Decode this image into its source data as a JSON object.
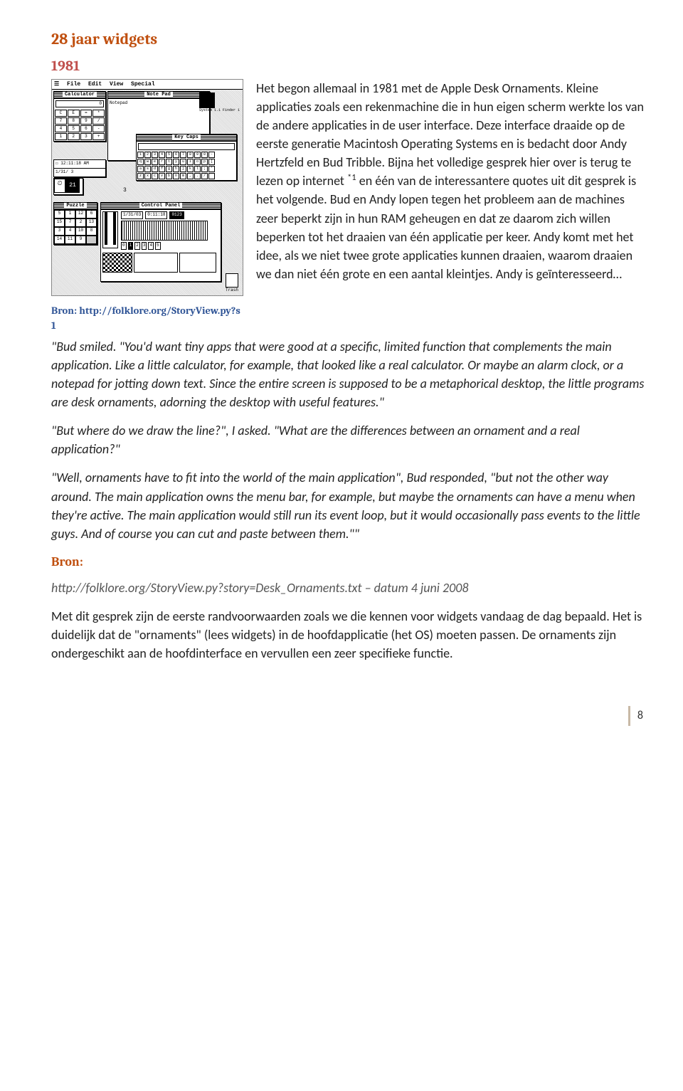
{
  "title": "28 jaar widgets",
  "year": "1981",
  "figure": {
    "caption": "Bron: http://folklore.org/StoryView.py?s 1",
    "menubar": [
      "File",
      "Edit",
      "View",
      "Special"
    ],
    "windows": {
      "calculator": "Calculator",
      "notepad": "Note Pad",
      "notepad_inner": "Notepad",
      "keycaps": "Key Caps",
      "puzzle": "Puzzle",
      "control_panel": "Control Panel",
      "clock_text": "12:11:18 AM",
      "calendar_text": "1/31/ 3",
      "cp_date": "1/31/03",
      "cp_time": "0:11:18",
      "system_label": "System 1.1 Finder 1",
      "trash": "Trash"
    }
  },
  "paragraphs": {
    "p1_a": "Het begon allemaal in 1981 met de Apple Desk Ornaments. Kleine applicaties zoals een rekenmachine die in hun eigen scherm werkte los van de andere applicaties in de user interface. Deze interface draaide op de eerste generatie Macintosh Operating Systems en is bedacht door Andy Hertzfeld en Bud Tribble. Bijna het volledige gesprek hier over is terug te lezen op internet ",
    "p1_sup": "*1",
    "p1_b": " en één van de interessantere quotes uit dit gesprek is het volgende. Bud en Andy lopen tegen het probleem aan de machines zeer beperkt zijn in hun RAM geheugen en dat ze daarom zich willen beperken tot het draaien van één applicatie per keer. Andy komt met het idee, als we niet twee grote applicaties kunnen draaien, waarom draaien we dan niet één grote en een aantal kleintjes. Andy is geïnteresseerd…",
    "quote1": "\"Bud smiled. \"You'd want tiny apps that were good at a specific, limited function that complements the main application. Like a little calculator, for example, that looked like a real calculator. Or maybe an alarm clock, or a notepad for jotting down text. Since the entire screen is supposed to be a metaphorical desktop, the little programs are desk ornaments, adorning the desktop with useful features.\"",
    "quote2": "\"But where do we draw the line?\", I asked. \"What are the differences between an ornament and a real application?\"",
    "quote3": "\"Well, ornaments have to fit into the world of the main application\", Bud responded, \"but not the other way around. The main application owns the menu bar, for example, but maybe the ornaments can have a menu when they're active. The main application would still run its event loop, but it would occasionally pass events to the little guys. And of course you can cut and paste between them.\"\"",
    "bron_heading": "Bron:",
    "source": "http://folklore.org/StoryView.py?story=Desk_Ornaments.txt – datum 4 juni 2008",
    "p2": "Met dit gesprek zijn de eerste randvoorwaarden zoals we die kennen voor widgets vandaag de dag bepaald. Het is duidelijk dat de  \"ornaments\" (lees widgets) in de hoofdapplicatie (het OS) moeten passen. De ornaments zijn ondergeschikt aan de hoofdinterface en vervullen een zeer specifieke functie."
  },
  "page_number": "8"
}
